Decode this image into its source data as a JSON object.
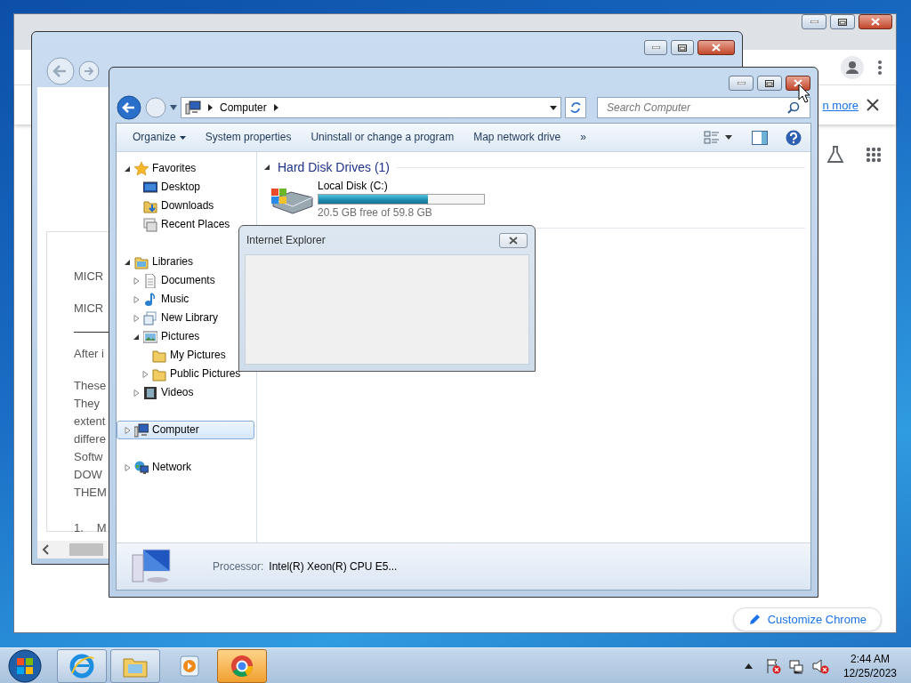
{
  "chrome": {
    "infobar_link": "n more",
    "customize_button": "Customize Chrome"
  },
  "ie_window": {
    "article": [
      {
        "kind": "text",
        "lines": [
          "MICR"
        ]
      },
      {
        "kind": "text",
        "lines": [
          "MICR"
        ]
      },
      {
        "kind": "rule"
      },
      {
        "kind": "text",
        "lines": [
          "After i"
        ]
      },
      {
        "kind": "text",
        "lines": [
          "These",
          "They",
          "extent",
          "differe",
          "Softw",
          "DOW",
          "THEM"
        ]
      },
      {
        "kind": "list",
        "number": "1.",
        "text": "M"
      }
    ]
  },
  "explorer": {
    "address": "Computer",
    "search": {
      "placeholder": "Search Computer"
    },
    "toolbar": [
      {
        "label": "Organize",
        "dropdown": true
      },
      {
        "label": "System properties",
        "dropdown": false
      },
      {
        "label": "Uninstall or change a program",
        "dropdown": false
      },
      {
        "label": "Map network drive",
        "dropdown": false
      },
      {
        "label": "»",
        "dropdown": false
      }
    ],
    "nav": [
      {
        "label": "Favorites",
        "kind": "star",
        "expanded": true,
        "selected": false,
        "children": [
          {
            "label": "Desktop",
            "kind": "desktop",
            "selected": false
          },
          {
            "label": "Downloads",
            "kind": "download",
            "selected": false
          },
          {
            "label": "Recent Places",
            "kind": "recent",
            "selected": false
          }
        ]
      },
      {
        "label": "Libraries",
        "kind": "library",
        "expanded": true,
        "selected": false,
        "children": [
          {
            "label": "Documents",
            "kind": "document",
            "expanded": false,
            "selected": false
          },
          {
            "label": "Music",
            "kind": "music",
            "expanded": false,
            "selected": false
          },
          {
            "label": "New Library",
            "kind": "library-item",
            "expanded": false,
            "selected": false
          },
          {
            "label": "Pictures",
            "kind": "picture",
            "expanded": true,
            "selected": false,
            "children": [
              {
                "label": "My Pictures",
                "kind": "folder",
                "selected": false
              },
              {
                "label": "Public Pictures",
                "kind": "folder",
                "expanded": false,
                "selected": false
              }
            ]
          },
          {
            "label": "Videos",
            "kind": "video",
            "expanded": false,
            "selected": false
          }
        ]
      },
      {
        "label": "Computer",
        "kind": "computer",
        "expanded": false,
        "selected": true
      },
      {
        "label": "Network",
        "kind": "network",
        "expanded": false,
        "selected": false
      }
    ],
    "groups": [
      {
        "title": "Hard Disk Drives (1)",
        "expanded": true,
        "drives": [
          {
            "name": "Local Disk (C:)",
            "level": 0.66,
            "free": "20.5 GB free of 59.8 GB"
          }
        ]
      }
    ],
    "details": {
      "label": "Processor:",
      "value": "Intel(R) Xeon(R) CPU E5..."
    }
  },
  "dialog": {
    "title": "Internet Explorer"
  },
  "taskbar": {
    "apps": [
      {
        "kind": "ie",
        "running": true,
        "selected": false
      },
      {
        "kind": "explorer",
        "running": true,
        "selected": false
      },
      {
        "kind": "media",
        "running": false,
        "selected": false
      },
      {
        "kind": "chrome",
        "running": true,
        "selected": true
      }
    ],
    "clock": {
      "time": "2:44 AM",
      "date": "12/25/2023"
    }
  }
}
